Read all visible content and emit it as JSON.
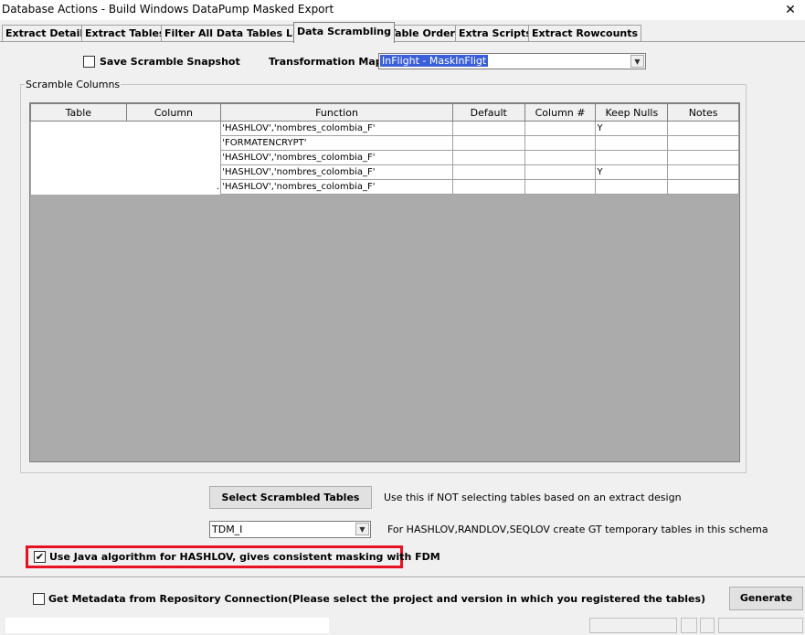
{
  "window": {
    "title": "Database Actions - Build Windows DataPump Masked Export",
    "close_glyph": "✕"
  },
  "tabs": [
    {
      "label": "Extract Details"
    },
    {
      "label": "Extract Tables"
    },
    {
      "label": "Filter All Data Tables List"
    },
    {
      "label": "Data Scrambling"
    },
    {
      "label": "Table Order"
    },
    {
      "label": "Extra Scripts"
    },
    {
      "label": "Extract Rowcounts"
    }
  ],
  "top": {
    "save_snapshot_label": "Save Scramble Snapshot",
    "save_snapshot_checked": false,
    "transformation_map_label": "Transformation Map:",
    "transformation_map_value": "InFlight - MaskInFligt"
  },
  "scramble_columns": {
    "group_label": "Scramble Columns",
    "headers": [
      "Table",
      "Column",
      "Function",
      "Default",
      "Column #",
      "Keep Nulls",
      "Notes"
    ],
    "rows": [
      {
        "table": "",
        "column": "",
        "function": "'HASHLOV','nombres_colombia_F'",
        "default": "",
        "column_no": "",
        "keep_nulls": "Y",
        "notes": ""
      },
      {
        "table": "",
        "column": "",
        "function": "'FORMATENCRYPT'",
        "default": "",
        "column_no": "",
        "keep_nulls": "",
        "notes": ""
      },
      {
        "table": "",
        "column": "",
        "function": "'HASHLOV','nombres_colombia_F'",
        "default": "",
        "column_no": "",
        "keep_nulls": "",
        "notes": ""
      },
      {
        "table": "",
        "column": "",
        "function": "'HASHLOV','nombres_colombia_F'",
        "default": "",
        "column_no": "",
        "keep_nulls": "Y",
        "notes": ""
      },
      {
        "table": "",
        "column": ".",
        "function": "'HASHLOV','nombres_colombia_F'",
        "default": "",
        "column_no": "",
        "keep_nulls": "",
        "notes": ""
      }
    ]
  },
  "select_tables": {
    "button_label": "Select Scrambled Tables",
    "hint": "Use this if NOT selecting tables based on an extract design"
  },
  "schema": {
    "value": "TDM_I",
    "hint": "For HASHLOV,RANDLOV,SEQLOV create GT temporary tables in this schema"
  },
  "java_algorithm": {
    "label": "Use Java algorithm for HASHLOV, gives consistent masking with FDM",
    "checked": true,
    "highlight_color": "#e81123"
  },
  "footer": {
    "metadata_label": "Get Metadata from Repository Connection(Please select the project and version in which you registered the tables)",
    "metadata_checked": false,
    "generate_label": "Generate"
  },
  "icons": {
    "checkmark": "✔",
    "dropdown_arrow": "▼"
  }
}
